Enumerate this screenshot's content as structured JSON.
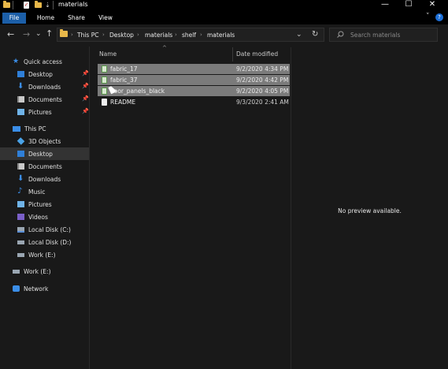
{
  "window": {
    "title": "materials",
    "quick_access_icons": [
      "folder-icon",
      "properties-icon",
      "new-folder-icon",
      "customize-dropdown-icon"
    ],
    "controls": {
      "minimize": "—",
      "maximize": "☐",
      "close": "✕"
    }
  },
  "ribbon": {
    "tabs": [
      "File",
      "Home",
      "Share",
      "View"
    ],
    "active_tab": "File",
    "accent": "#1c5fa8",
    "expand_icon": "˅",
    "help_icon": "?"
  },
  "navigation": {
    "back": "←",
    "forward": "→",
    "recent": "⌄",
    "up": "↑",
    "breadcrumb": [
      "This PC",
      "Desktop",
      "materials",
      "shelf",
      "materials"
    ],
    "separator": "›",
    "dropdown": "⌄",
    "refresh": "↻",
    "search_placeholder": "Search materials"
  },
  "sidebar": {
    "quick_access_label": "Quick access",
    "quick_access": [
      {
        "label": "Desktop",
        "pinned": true,
        "icon": "desktop-icon"
      },
      {
        "label": "Downloads",
        "pinned": true,
        "icon": "downloads-icon"
      },
      {
        "label": "Documents",
        "pinned": true,
        "icon": "documents-icon"
      },
      {
        "label": "Pictures",
        "pinned": true,
        "icon": "pictures-icon"
      }
    ],
    "this_pc_label": "This PC",
    "this_pc": [
      {
        "label": "3D Objects",
        "icon": "3d-objects-icon"
      },
      {
        "label": "Desktop",
        "icon": "desktop-icon",
        "selected": true
      },
      {
        "label": "Documents",
        "icon": "documents-icon"
      },
      {
        "label": "Downloads",
        "icon": "downloads-icon"
      },
      {
        "label": "Music",
        "icon": "music-icon"
      },
      {
        "label": "Pictures",
        "icon": "pictures-icon"
      },
      {
        "label": "Videos",
        "icon": "videos-icon"
      },
      {
        "label": "Local Disk (C:)",
        "icon": "drive-icon"
      },
      {
        "label": "Local Disk (D:)",
        "icon": "drive-icon"
      },
      {
        "label": "Work (E:)",
        "icon": "drive-icon"
      }
    ],
    "work_drive_label": "Work (E:)",
    "network_label": "Network"
  },
  "file_list": {
    "columns": {
      "name": "Name",
      "date": "Date modified"
    },
    "sort_indicator": "^",
    "rows": [
      {
        "name": "fabric_17",
        "date": "9/2/2020 4:34 PM",
        "selected": true,
        "icon": "image-file-icon"
      },
      {
        "name": "fabric_37",
        "date": "9/2/2020 4:42 PM",
        "selected": true,
        "icon": "image-file-icon"
      },
      {
        "name": "floor_panels_black",
        "date": "9/2/2020 4:05 PM",
        "selected": true,
        "icon": "image-file-icon"
      },
      {
        "name": "README",
        "date": "9/3/2020 2:41 AM",
        "selected": false,
        "icon": "text-file-icon"
      }
    ]
  },
  "preview": {
    "text": "No preview available."
  }
}
